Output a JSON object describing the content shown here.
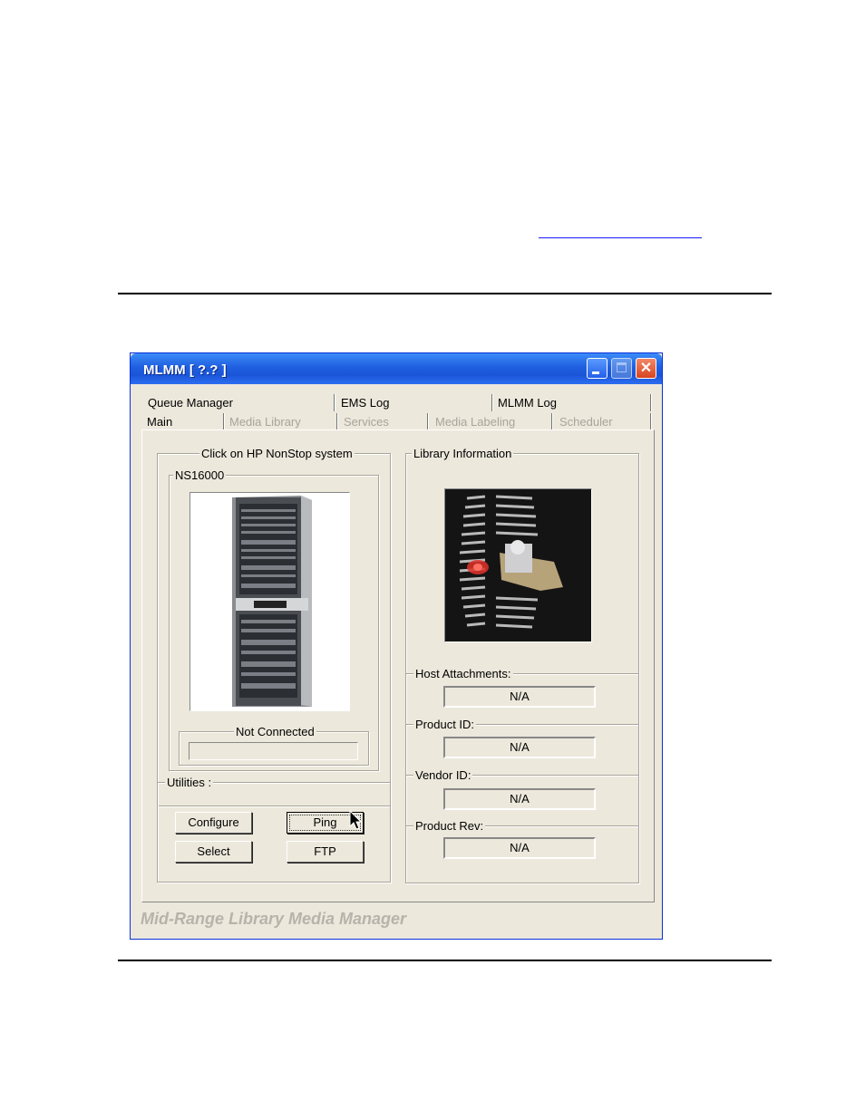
{
  "window": {
    "title": "MLMM [ ?.? ]",
    "footer": "Mid-Range Library Media Manager"
  },
  "tabs_row1": [
    "Queue Manager",
    "EMS Log",
    "MLMM Log"
  ],
  "tabs_row2": [
    {
      "label": "Main",
      "enabled": true
    },
    {
      "label": "Media Library",
      "enabled": false
    },
    {
      "label": "Services",
      "enabled": false
    },
    {
      "label": "Media Labeling",
      "enabled": false
    },
    {
      "label": "Scheduler",
      "enabled": false
    }
  ],
  "system_group": {
    "legend": "Click on HP NonStop system",
    "system_name": "NS16000",
    "status_label": "Not Connected"
  },
  "utilities": {
    "legend": "Utilities :",
    "configure": "Configure",
    "ping": "Ping",
    "select": "Select",
    "ftp": "FTP"
  },
  "library": {
    "legend": "Library Information",
    "host_attachments_label": "Host Attachments:",
    "host_attachments_value": "N/A",
    "product_id_label": "Product ID:",
    "product_id_value": "N/A",
    "vendor_id_label": "Vendor ID:",
    "vendor_id_value": "N/A",
    "product_rev_label": "Product Rev:",
    "product_rev_value": "N/A"
  },
  "colors": {
    "titlebar": "#1f5fe0",
    "window_bg": "#ece8dc",
    "disabled_text": "#a8a49a"
  }
}
